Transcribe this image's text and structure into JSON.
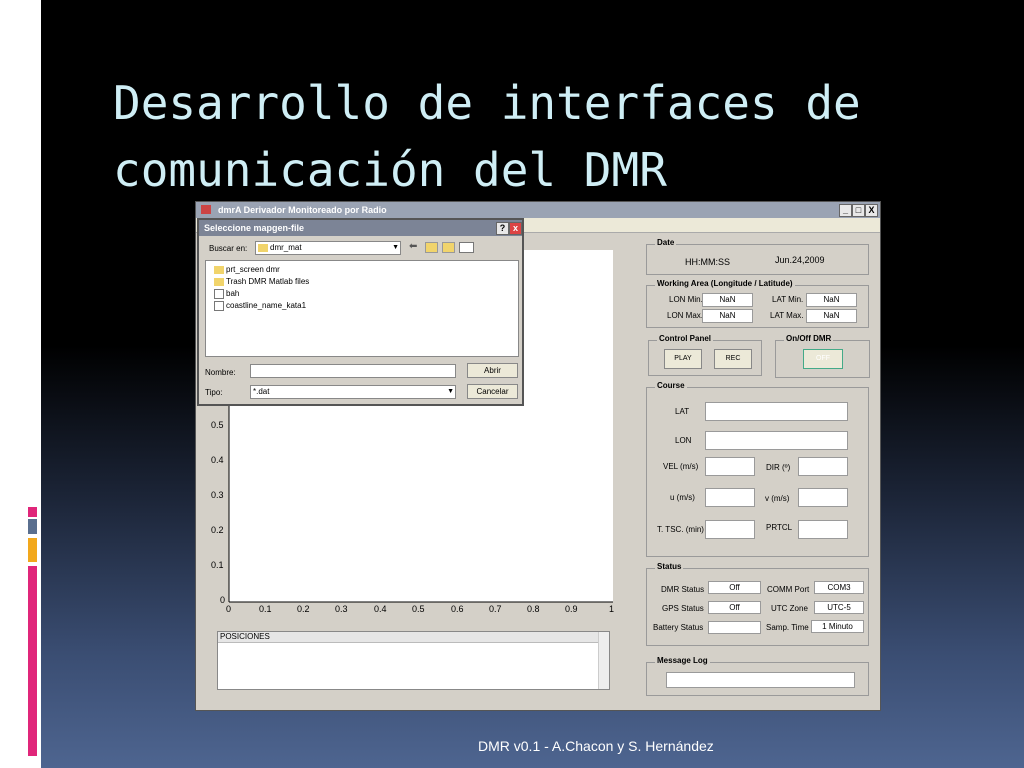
{
  "slide": {
    "title": "Desarrollo de interfaces de comunicación del DMR",
    "footer": "DMR v0.1 - A.Chacon y S. Hernández"
  },
  "main_window": {
    "title": "dmrA Derivador Monitoreado por Radio",
    "controls": {
      "minimize": "_",
      "maximize": "□",
      "close": "X"
    },
    "plot": {
      "x_ticks": [
        "0",
        "0.1",
        "0.2",
        "0.3",
        "0.4",
        "0.5",
        "0.6",
        "0.7",
        "0.8",
        "0.9",
        "1"
      ],
      "y_ticks": [
        "0.5",
        "0.4",
        "0.3",
        "0.2",
        "0.1",
        "0"
      ]
    },
    "positions_list": {
      "header": "POSICIONES"
    },
    "date": {
      "legend": "Date",
      "time": "HH:MM:SS",
      "date_value": "Jun.24,2009"
    },
    "working_area": {
      "legend": "Working Area (Longitude / Latitude)",
      "lon_min_label": "LON Min.",
      "lon_min": "NaN",
      "lon_max_label": "LON Max.",
      "lon_max": "NaN",
      "lat_min_label": "LAT Min.",
      "lat_min": "NaN",
      "lat_max_label": "LAT Max.",
      "lat_max": "NaN"
    },
    "control_panel": {
      "legend": "Control Panel",
      "play": "PLAY",
      "rec": "REC"
    },
    "onoff": {
      "legend": "On/Off DMR",
      "button": "OFF"
    },
    "course": {
      "legend": "Course",
      "lat": "LAT",
      "lon": "LON",
      "vel": "VEL (m/s)",
      "dir": "DIR (º)",
      "u": "u (m/s)",
      "v": "v (m/s)",
      "ttsc": "T. TSC. (min)",
      "prtcl": "PRTCL"
    },
    "status": {
      "legend": "Status",
      "dmr_status_label": "DMR Status",
      "dmr_status": "Off",
      "gps_status_label": "GPS Status",
      "gps_status": "Off",
      "battery_label": "Battery Status",
      "battery": "",
      "comm_port_label": "COMM Port",
      "comm_port": "COM3",
      "utc_zone_label": "UTC Zone",
      "utc_zone": "UTC-5",
      "samp_time_label": "Samp. Time",
      "samp_time": "1 Minuto"
    },
    "message_log": {
      "legend": "Message Log"
    }
  },
  "dialog": {
    "title": "Seleccione mapgen-file",
    "buscar_label": "Buscar en:",
    "folder": "dmr_mat",
    "files": [
      {
        "name": "prt_screen dmr",
        "icon": "folder-icon"
      },
      {
        "name": "Trash DMR Matlab files",
        "icon": "folder-icon"
      },
      {
        "name": "bah",
        "icon": "file-icon"
      },
      {
        "name": "coastline_name_kata1",
        "icon": "file-icon"
      }
    ],
    "nombre_label": "Nombre:",
    "nombre_value": "",
    "tipo_label": "Tipo:",
    "tipo_value": "*.dat",
    "open_button": "Abrir",
    "cancel_button": "Cancelar"
  },
  "colors": {
    "title_text": "#cfeef5",
    "accent_pink": "#e0267a",
    "accent_orange": "#f2a81d",
    "accent_slate": "#5a6f8f"
  }
}
